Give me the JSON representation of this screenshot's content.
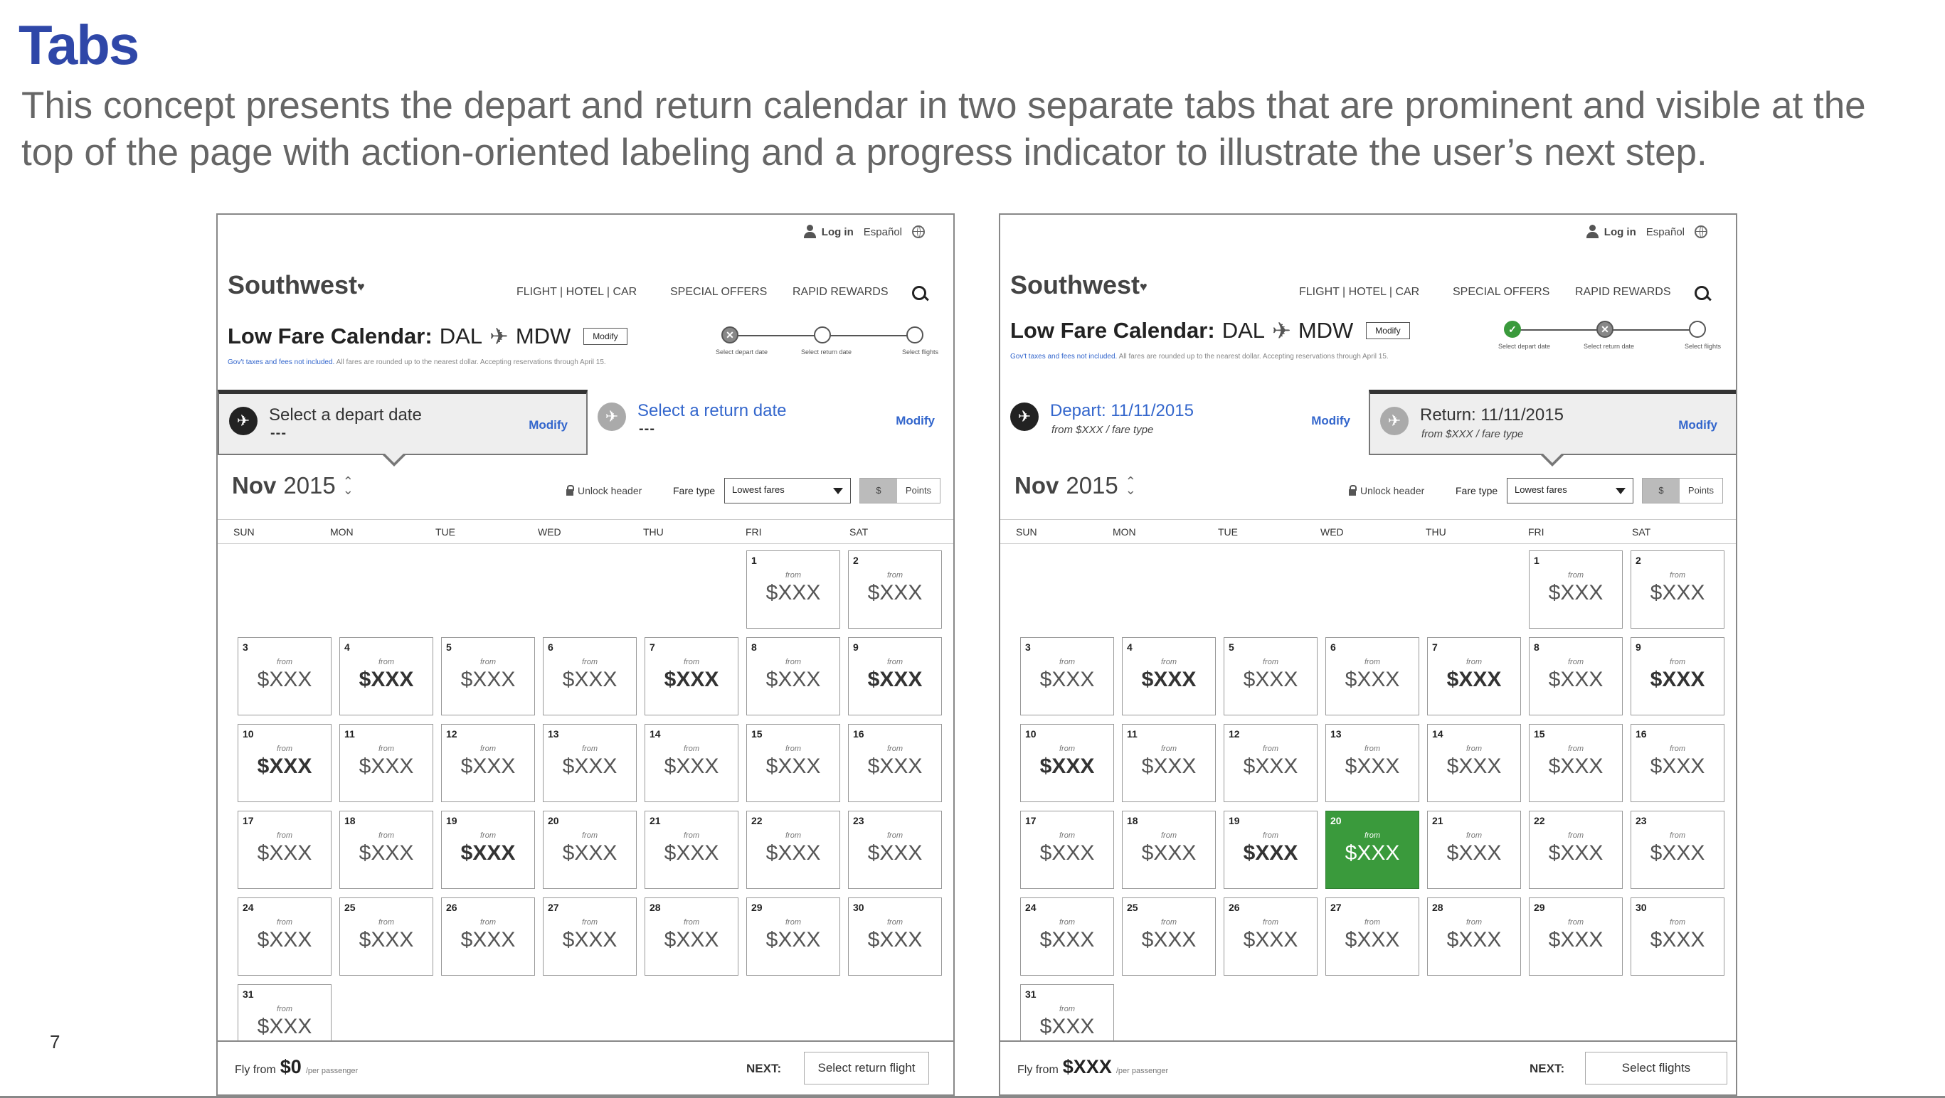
{
  "slide": {
    "title": "Tabs",
    "description": "This concept presents the depart and return calendar in two separate tabs that are prominent and visible at the top of the page with action-oriented labeling and a progress indicator to illustrate the user’s next step.",
    "page_number": "7"
  },
  "common": {
    "login": "Log in",
    "language": "Español",
    "brand": "Southwest",
    "brand_heart": "♥",
    "nav": [
      "FLIGHT | HOTEL | CAR",
      "SPECIAL OFFERS",
      "RAPID REWARDS"
    ],
    "lfc_label": "Low Fare Calendar:",
    "origin": "DAL",
    "destination": "MDW",
    "plane_glyph": "✈",
    "modify": "Modify",
    "tax_link": "Gov't taxes and fees not included.",
    "tax_note": "All fares are rounded up to the nearest dollar. Accepting reservations through April 15.",
    "progress_labels": [
      "Select depart date",
      "Select return date",
      "Select flights"
    ],
    "month": "Nov",
    "year": "2015",
    "unlock_header": "Unlock header",
    "fare_type_label": "Fare type",
    "fare_type_value": "Lowest fares",
    "seg_dollar": "$",
    "seg_points": "Points",
    "weekdays": [
      "SUN",
      "MON",
      "TUE",
      "WED",
      "THU",
      "FRI",
      "SAT"
    ],
    "from": "from",
    "price": "$XXX",
    "fly_from": "Fly from",
    "per_passenger": "/per passenger",
    "next": "NEXT:"
  },
  "left": {
    "tab1_label": "Select a depart date",
    "tab1_dash": "---",
    "tab1_modify": "Modify",
    "tab2_label": "Select a return date",
    "tab2_dash": "---",
    "tab2_modify": "Modify",
    "progress_state": [
      "current",
      "todo",
      "todo"
    ],
    "bold_days": [
      4,
      7,
      9,
      10,
      19
    ],
    "selected_day": null,
    "fly_amount": "$0",
    "next_button": "Select return flight"
  },
  "right": {
    "tab1_label": "Depart: 11/11/2015",
    "tab1_sub": "from $XXX / fare type",
    "tab1_modify": "Modify",
    "tab2_label": "Return: 11/11/2015",
    "tab2_sub": "from $XXX / fare type",
    "tab2_modify": "Modify",
    "progress_state": [
      "done",
      "current",
      "todo"
    ],
    "bold_days": [
      4,
      7,
      9,
      10,
      19
    ],
    "selected_day": 20,
    "fly_amount": "$XXX",
    "next_button": "Select flights"
  },
  "calendar": {
    "first_weekday": 5,
    "days_in_month": 31
  }
}
